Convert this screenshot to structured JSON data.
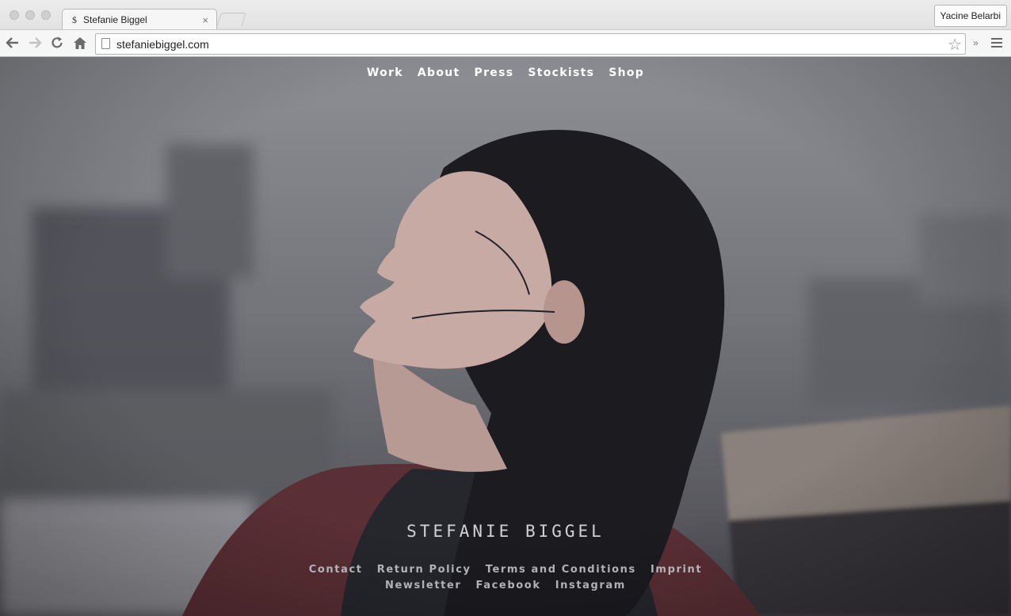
{
  "browser": {
    "tab_title": "Stefanie Biggel",
    "tab_favicon": "$",
    "tab_close": "×",
    "url": "stefaniebiggel.com",
    "profile_name": "Yacine Belarbi",
    "icons": [
      "back-arrow-icon",
      "forward-arrow-icon",
      "reload-icon",
      "home-icon",
      "page-icon",
      "star-icon",
      "extensions-overflow-icon",
      "hamburger-menu-icon"
    ],
    "overflow_label": "»"
  },
  "site": {
    "nav": [
      "Work",
      "About",
      "Press",
      "Stockists",
      "Shop"
    ],
    "brand": "STEFANIE BIGGEL",
    "footer_row1": [
      "Contact",
      "Return Policy",
      "Terms and Conditions",
      "Imprint"
    ],
    "footer_row2": [
      "Newsletter",
      "Facebook",
      "Instagram"
    ]
  },
  "colors": {
    "nav_text": "#ffffff",
    "brand_text": "#e4e4e8",
    "footer_text": "#bebec4"
  }
}
